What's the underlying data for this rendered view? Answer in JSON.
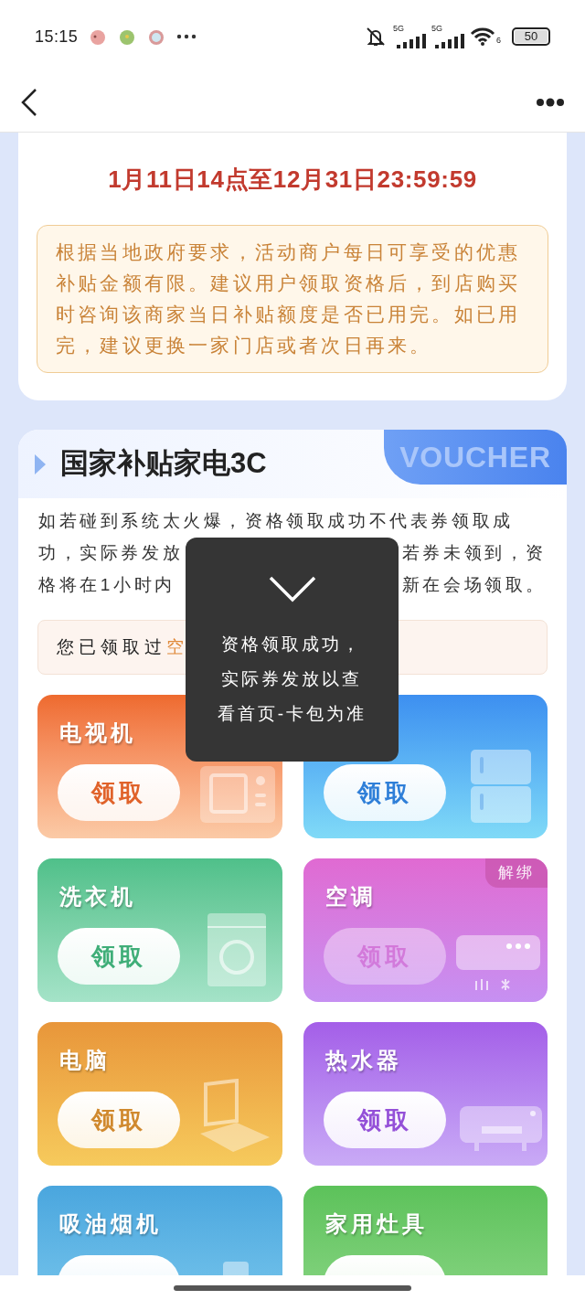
{
  "status_bar": {
    "time": "15:15",
    "network_1": "5G",
    "network_2": "5G",
    "wifi_badge": "6",
    "battery": "50"
  },
  "period": "1月11日14点至12月31日23:59:59",
  "notice": "根据当地政府要求，活动商户每日可享受的优惠补贴金额有限。建议用户领取资格后，到店购买时咨询该商家当日补贴额度是否已用完。如已用完，建议更换一家门店或者次日再来。",
  "voucher": {
    "title": "国家补贴家电3C",
    "watermark": "VOUCHER",
    "description_lines": [
      {
        "left": "如若碰到系统太火爆，资格领取成功不代表券领取成"
      },
      {
        "left": "功，实际券发放",
        "right": "若券未领到，资"
      },
      {
        "left": "格将在1小时内",
        "right": "新在会场领取。"
      }
    ],
    "received_prefix": "您已领取过",
    "received_highlight": "空"
  },
  "cards": [
    {
      "kind": "tv",
      "name": "电视机",
      "button": "领取",
      "color": "#ee6a2e",
      "disabled": false
    },
    {
      "kind": "fridge",
      "button": "领取",
      "color": "#3d8ff0",
      "disabled": false
    },
    {
      "kind": "washer",
      "name": "洗衣机",
      "button": "领取",
      "color": "#4fc08a",
      "disabled": false
    },
    {
      "kind": "aircon",
      "name": "空调",
      "button": "领取",
      "color": "#e06ad2",
      "disabled": true,
      "badge": "解绑"
    },
    {
      "kind": "laptop",
      "name": "电脑",
      "button": "领取",
      "color": "#e8963a",
      "disabled": false
    },
    {
      "kind": "heater",
      "name": "热水器",
      "button": "领取",
      "color": "#a45ee8",
      "disabled": false
    },
    {
      "kind": "hood",
      "name": "吸油烟机",
      "color": "#4aa6de",
      "disabled": false
    },
    {
      "kind": "stove",
      "name": "家用灶具",
      "color": "#5cc25a",
      "disabled": false
    }
  ],
  "toast": {
    "message_lines": [
      "资格领取成功，",
      "实际券发放以查",
      "看首页-卡包为准"
    ]
  }
}
